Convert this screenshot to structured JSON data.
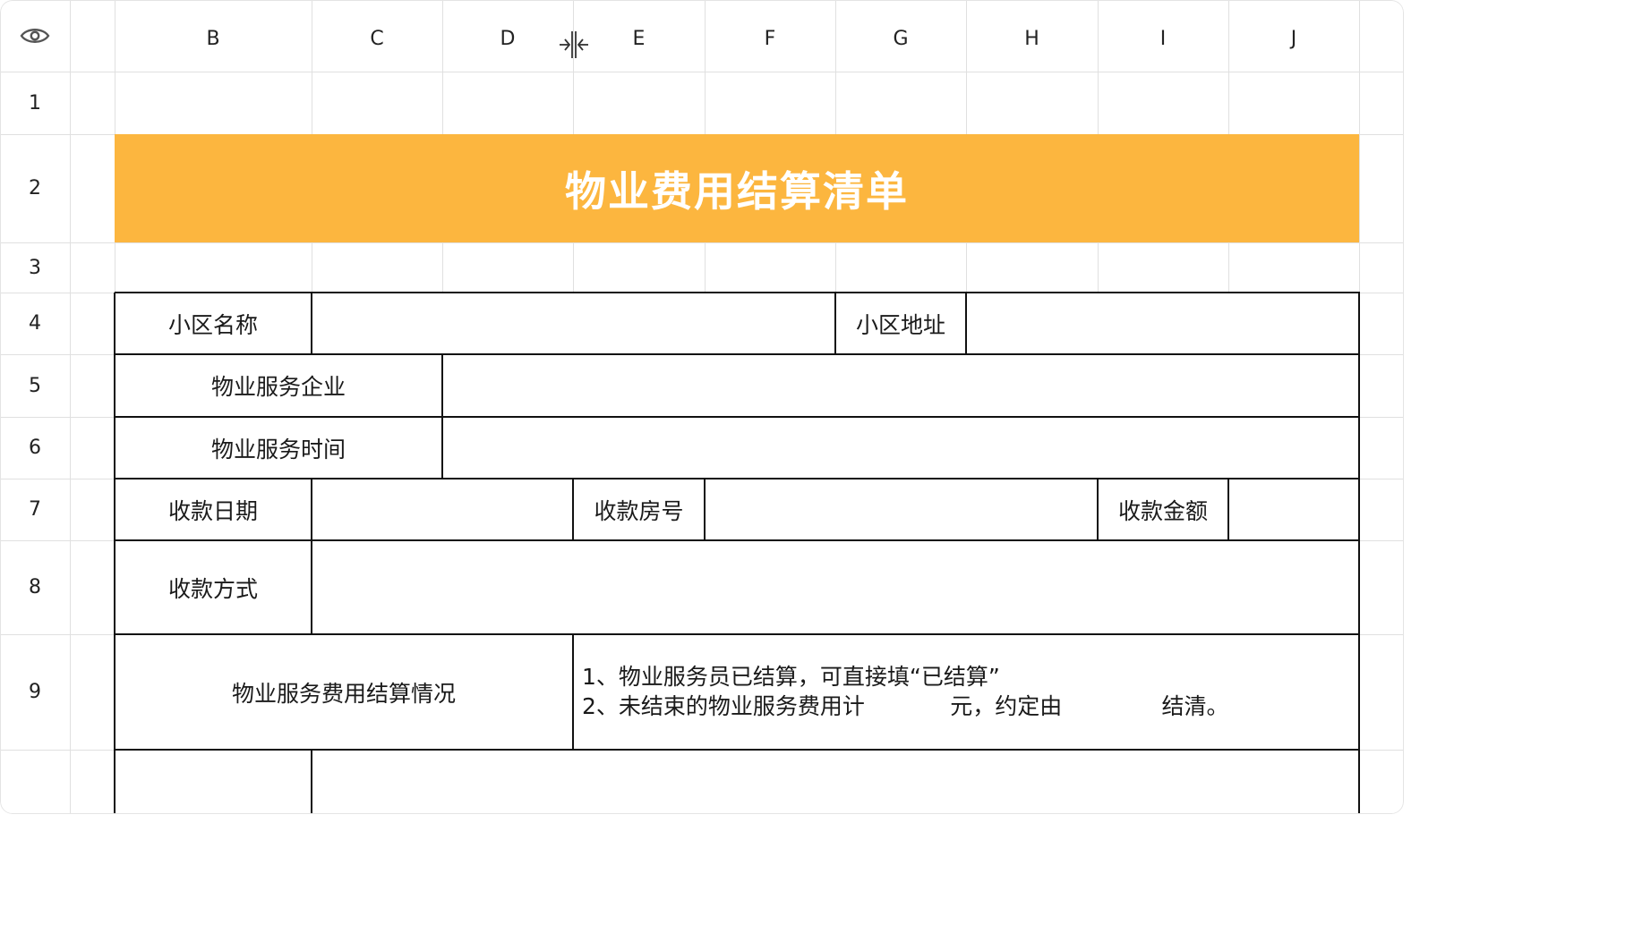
{
  "columns": [
    "B",
    "C",
    "D",
    "E",
    "F",
    "G",
    "H",
    "I",
    "J"
  ],
  "rows": [
    "1",
    "2",
    "3",
    "4",
    "5",
    "6",
    "7",
    "8",
    "9"
  ],
  "icons": {
    "corner": "eye-icon",
    "column_resize": "column-resize-icon"
  },
  "colors": {
    "title_bg": "#fcb63f",
    "title_text": "#ffffff",
    "grid": "#e0e0e0",
    "border": "#111111"
  },
  "form": {
    "title": "物业费用结算清单",
    "community_name_label": "小区名称",
    "community_address_label": "小区地址",
    "service_company_label": "物业服务企业",
    "service_time_label": "物业服务时间",
    "payment_date_label": "收款日期",
    "room_number_label": "收款房号",
    "amount_label": "收款金额",
    "payment_method_label": "收款方式",
    "settlement_label": "物业服务费用结算情况",
    "settlement_note_1": "1、物业服务员已结算，可直接填“已结算”",
    "settlement_note_2": "2、未结束的物业服务费用计            元，约定由              结清。"
  }
}
